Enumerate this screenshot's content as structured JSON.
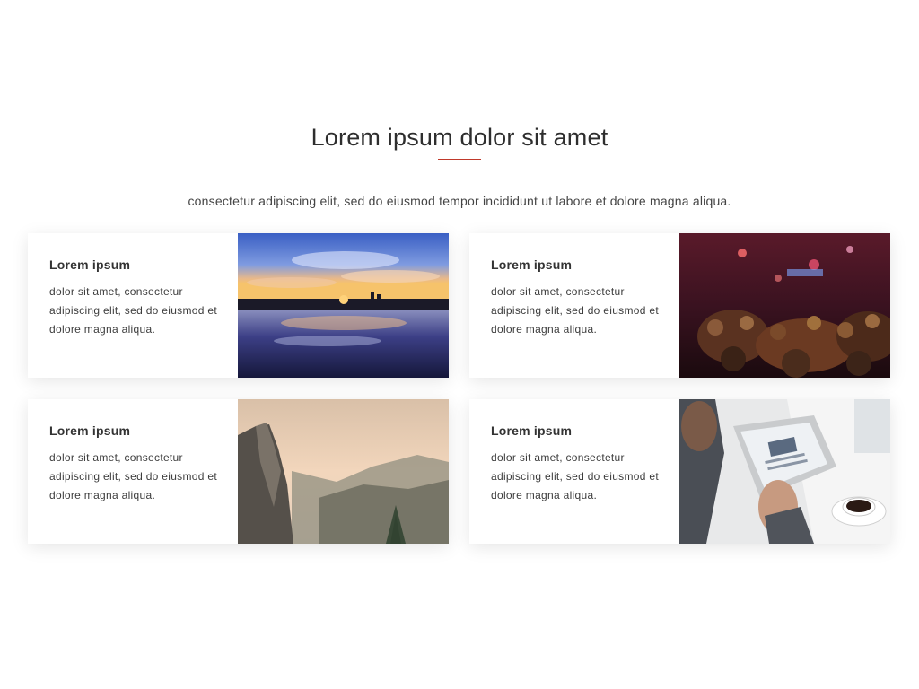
{
  "section": {
    "title": "Lorem ipsum dolor sit amet",
    "subtitle": "consectetur adipiscing elit, sed do eiusmod tempor incididunt ut labore et dolore magna aliqua.",
    "accent_color": "#c0392b"
  },
  "cards": [
    {
      "heading": "Lorem ipsum",
      "body": "dolor sit amet, consectetur adipiscing elit, sed do eiusmod et dolore magna aliqua.",
      "image": "sunset-lake-photo"
    },
    {
      "heading": "Lorem ipsum",
      "body": "dolor sit amet, consectetur adipiscing elit, sed do eiusmod et dolore magna aliqua.",
      "image": "concert-crowd-photo"
    },
    {
      "heading": "Lorem ipsum",
      "body": "dolor sit amet, consectetur adipiscing elit, sed do eiusmod et dolore magna aliqua.",
      "image": "mountain-cliff-photo"
    },
    {
      "heading": "Lorem ipsum",
      "body": "dolor sit amet, consectetur adipiscing elit, sed do eiusmod et dolore magna aliqua.",
      "image": "tablet-coffee-photo"
    }
  ]
}
